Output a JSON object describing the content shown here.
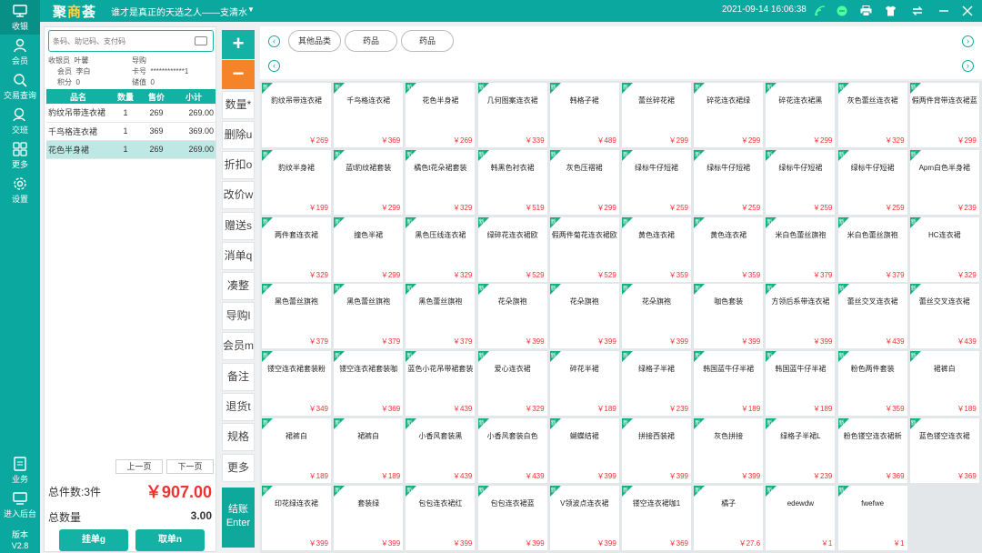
{
  "nav": {
    "items": [
      {
        "label": "收银",
        "icon": "monitor-icon"
      },
      {
        "label": "会员",
        "icon": "user-icon"
      },
      {
        "label": "交易查询",
        "icon": "search-icon"
      },
      {
        "label": "交班",
        "icon": "handover-icon"
      },
      {
        "label": "更多",
        "icon": "grid-icon"
      },
      {
        "label": "设置",
        "icon": "gear-icon"
      }
    ],
    "bottom_items": [
      {
        "label": "业务",
        "icon": "doc-icon"
      },
      {
        "label": "进入后台",
        "icon": "backend-icon"
      }
    ],
    "version_label": "版本",
    "version": "V2.8"
  },
  "topbar": {
    "brand_a": "聚",
    "brand_b": "商",
    "brand_c": "荟",
    "slogan": "谁才是真正的天选之人——支清水",
    "datetime": "2021-09-14 16:06:38"
  },
  "order": {
    "scan_placeholder": "条码、助记码、支付码",
    "cashier_label": "收银员",
    "cashier": "叶馨",
    "guide_label": "导购",
    "guide": "",
    "member_label": "会员",
    "member": "李白",
    "card_label": "卡号",
    "card": "************1",
    "points_label": "积分",
    "points": "0",
    "stored_label": "储值",
    "stored": "0",
    "columns": [
      "品名",
      "数量",
      "售价",
      "小计"
    ],
    "rows": [
      {
        "name": "豹纹吊带连衣裙",
        "qty": "1",
        "price": "269",
        "subtotal": "269.00"
      },
      {
        "name": "千鸟格连衣裙",
        "qty": "1",
        "price": "369",
        "subtotal": "369.00"
      },
      {
        "name": "花色半身裙",
        "qty": "1",
        "price": "269",
        "subtotal": "269.00"
      }
    ],
    "prev_page": "上一页",
    "next_page": "下一页",
    "total_count_label": "总件数:3件",
    "total_amount": "￥907.00",
    "total_qty_label": "总数量",
    "total_qty": "3.00",
    "hold_button": "挂单g",
    "cancel_button": "取单n"
  },
  "functions": {
    "plus": "+",
    "minus": "−",
    "buttons": [
      "数量*",
      "删除u",
      "折扣o",
      "改价w",
      "赠送s",
      "消单q",
      "凑整",
      "导购l",
      "会员m",
      "备注",
      "退货t",
      "规格",
      "更多"
    ],
    "checkout_a": "结账",
    "checkout_b": "Enter"
  },
  "categories": {
    "left_arrow": "‹",
    "right_arrow": "›",
    "items": [
      "其他品类",
      "药品",
      "药品"
    ]
  },
  "badge": "新",
  "products": [
    {
      "name": "豹纹吊带连衣裙",
      "price": "￥269"
    },
    {
      "name": "千鸟格连衣裙",
      "price": "￥369"
    },
    {
      "name": "花色半身裙",
      "price": "￥269"
    },
    {
      "name": "几何图案连衣裙",
      "price": "￥339"
    },
    {
      "name": "韩格子裙",
      "price": "￥489"
    },
    {
      "name": "蕾丝碎花裙",
      "price": "￥299"
    },
    {
      "name": "碎花连衣裙绿",
      "price": "￥299"
    },
    {
      "name": "碎花连衣裙黑",
      "price": "￥299"
    },
    {
      "name": "灰色蕾丝连衣裙",
      "price": "￥329"
    },
    {
      "name": "假两件背带连衣裙蓝",
      "price": "￥299"
    },
    {
      "name": "豹纹半身裙",
      "price": "￥199"
    },
    {
      "name": "蓝t豹纹裙套装",
      "price": "￥299"
    },
    {
      "name": "橘色t花朵裙套装",
      "price": "￥329"
    },
    {
      "name": "韩黑色衬衣裙",
      "price": "￥519"
    },
    {
      "name": "灰色压褶裙",
      "price": "￥299"
    },
    {
      "name": "绿标牛仔短裙",
      "price": "￥259"
    },
    {
      "name": "绿标牛仔短裙",
      "price": "￥259"
    },
    {
      "name": "绿标牛仔短裙",
      "price": "￥259"
    },
    {
      "name": "绿标牛仔短裙",
      "price": "￥259"
    },
    {
      "name": "Apm白色半身裙",
      "price": "￥239"
    },
    {
      "name": "两件套连衣裙",
      "price": "￥329"
    },
    {
      "name": "撞色半裙",
      "price": "￥299"
    },
    {
      "name": "黑色压线连衣裙",
      "price": "￥329"
    },
    {
      "name": "绿碎花连衣裙欧",
      "price": "￥529"
    },
    {
      "name": "假两件菊花连衣裙欧",
      "price": "￥529"
    },
    {
      "name": "黄色连衣裙",
      "price": "￥359"
    },
    {
      "name": "黄色连衣裙",
      "price": "￥359"
    },
    {
      "name": "米白色蕾丝旗袍",
      "price": "￥379"
    },
    {
      "name": "米白色蕾丝旗袍",
      "price": "￥379"
    },
    {
      "name": "HC连衣裙",
      "price": "￥329"
    },
    {
      "name": "黑色蕾丝旗袍",
      "price": "￥379"
    },
    {
      "name": "黑色蕾丝旗袍",
      "price": "￥379"
    },
    {
      "name": "黑色蕾丝旗袍",
      "price": "￥379"
    },
    {
      "name": "花朵旗袍",
      "price": "￥399"
    },
    {
      "name": "花朵旗袍",
      "price": "￥399"
    },
    {
      "name": "花朵旗袍",
      "price": "￥399"
    },
    {
      "name": "咖色套装",
      "price": "￥399"
    },
    {
      "name": "方领后系带连衣裙",
      "price": "￥399"
    },
    {
      "name": "蕾丝交叉连衣裙",
      "price": "￥439"
    },
    {
      "name": "蕾丝交叉连衣裙",
      "price": "￥439"
    },
    {
      "name": "镂空连衣裙套装粉",
      "price": "￥349"
    },
    {
      "name": "镂空连衣裙套装咖",
      "price": "￥369"
    },
    {
      "name": "蓝色小花吊带裙套装",
      "price": "￥439"
    },
    {
      "name": "爱心连衣裙",
      "price": "￥329"
    },
    {
      "name": "碎花半裙",
      "price": "￥189"
    },
    {
      "name": "绿格子半裙",
      "price": "￥239"
    },
    {
      "name": "韩国蓝牛仔半裙",
      "price": "￥189"
    },
    {
      "name": "韩国蓝牛仔半裙",
      "price": "￥189"
    },
    {
      "name": "粉色两件套装",
      "price": "￥359"
    },
    {
      "name": "裙裤白",
      "price": "￥189"
    },
    {
      "name": "裙裤白",
      "price": "￥189"
    },
    {
      "name": "裙裤白",
      "price": "￥189"
    },
    {
      "name": "小香风套装黑",
      "price": "￥439"
    },
    {
      "name": "小香风套装白色",
      "price": "￥439"
    },
    {
      "name": "蝴蝶结裙",
      "price": "￥399"
    },
    {
      "name": "拼接西装裙",
      "price": "￥399"
    },
    {
      "name": "灰色拼接",
      "price": "￥399"
    },
    {
      "name": "绿格子半裙L",
      "price": "￥239"
    },
    {
      "name": "粉色镂空连衣裙新",
      "price": "￥369"
    },
    {
      "name": "蓝色镂空连衣裙",
      "price": "￥369"
    },
    {
      "name": "印花绿连衣裙",
      "price": "￥399"
    },
    {
      "name": "套装绿",
      "price": "￥399"
    },
    {
      "name": "包包连衣裙红",
      "price": "￥399"
    },
    {
      "name": "包包连衣裙蓝",
      "price": "￥399"
    },
    {
      "name": "V领波点连衣裙",
      "price": "￥399"
    },
    {
      "name": "镂空连衣裙咖1",
      "price": "￥369"
    },
    {
      "name": "橘子",
      "price": "￥27.6"
    },
    {
      "name": "edewdw",
      "price": "￥1"
    },
    {
      "name": "fwefwe",
      "price": "￥1"
    }
  ]
}
